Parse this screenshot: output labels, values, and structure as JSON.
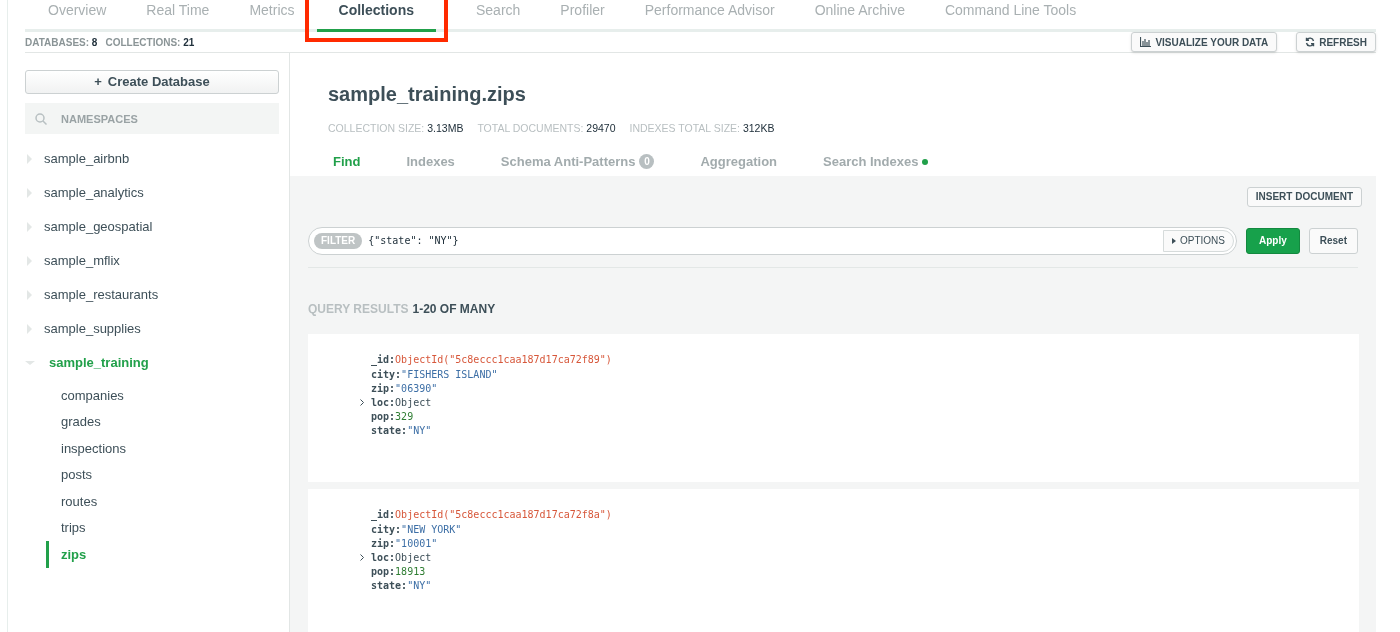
{
  "tabs": [
    {
      "label": "Overview",
      "selected": false,
      "highlighted": false
    },
    {
      "label": "Real Time",
      "selected": false,
      "highlighted": false
    },
    {
      "label": "Metrics",
      "selected": false,
      "highlighted": false
    },
    {
      "label": "Collections",
      "selected": true,
      "highlighted": true
    },
    {
      "label": "Search",
      "selected": false,
      "highlighted": false
    },
    {
      "label": "Profiler",
      "selected": false,
      "highlighted": false
    },
    {
      "label": "Performance Advisor",
      "selected": false,
      "highlighted": false
    },
    {
      "label": "Online Archive",
      "selected": false,
      "highlighted": false
    },
    {
      "label": "Command Line Tools",
      "selected": false,
      "highlighted": false
    }
  ],
  "stats": [
    {
      "label": "DATABASES:",
      "value": "8"
    },
    {
      "label": "COLLECTIONS:",
      "value": "21"
    }
  ],
  "toolbar_buttons": [
    {
      "kind": "chart",
      "label": "VISUALIZE YOUR DATA"
    },
    {
      "kind": "refresh",
      "label": "REFRESH"
    }
  ],
  "sidebar": {
    "create_button": {
      "icon": "+",
      "label": "Create Database"
    },
    "search": {
      "placeholder": "NAMESPACES"
    },
    "databases": [
      {
        "name": "sample_airbnb",
        "expanded": false
      },
      {
        "name": "sample_analytics",
        "expanded": false
      },
      {
        "name": "sample_geospatial",
        "expanded": false
      },
      {
        "name": "sample_mflix",
        "expanded": false
      },
      {
        "name": "sample_restaurants",
        "expanded": false
      },
      {
        "name": "sample_supplies",
        "expanded": false
      },
      {
        "name": "sample_training",
        "expanded": true,
        "children": [
          {
            "name": "companies",
            "selected": false
          },
          {
            "name": "grades",
            "selected": false
          },
          {
            "name": "inspections",
            "selected": false
          },
          {
            "name": "posts",
            "selected": false
          },
          {
            "name": "routes",
            "selected": false
          },
          {
            "name": "trips",
            "selected": false
          },
          {
            "name": "zips",
            "selected": true
          }
        ]
      }
    ]
  },
  "collection": {
    "title": "sample_training.zips",
    "stats": [
      {
        "label": "COLLECTION SIZE:",
        "value": "3.13MB"
      },
      {
        "label": "TOTAL DOCUMENTS:",
        "value": "29470"
      },
      {
        "label": "INDEXES TOTAL SIZE:",
        "value": "312KB"
      }
    ],
    "tabs": [
      {
        "label": "Find",
        "selected": true
      },
      {
        "label": "Indexes",
        "selected": false
      },
      {
        "label": "Schema Anti-Patterns",
        "selected": false,
        "badge": "0"
      },
      {
        "label": "Aggregation",
        "selected": false
      },
      {
        "label": "Search Indexes",
        "selected": false,
        "dot": true
      }
    ],
    "insert_button": "INSERT DOCUMENT",
    "filter": {
      "label": "FILTER",
      "value": "{\"state\": \"NY\"}",
      "options_button": "OPTIONS"
    },
    "apply_button": "Apply",
    "reset_button": "Reset",
    "results": {
      "label": "QUERY RESULTS",
      "range": "1-20 OF MANY"
    },
    "documents": [
      {
        "fields": [
          {
            "key": "_id:",
            "kind": "objectid",
            "value": "ObjectId(\"5c8eccc1caa187d17ca72f89\")"
          },
          {
            "key": "city:",
            "kind": "string",
            "value": "\"FISHERS ISLAND\""
          },
          {
            "key": "zip:",
            "kind": "string",
            "value": "\"06390\""
          },
          {
            "key": "loc:",
            "kind": "object",
            "value": "Object"
          },
          {
            "key": "pop:",
            "kind": "number",
            "value": "329"
          },
          {
            "key": "state:",
            "kind": "string",
            "value": "\"NY\""
          }
        ]
      },
      {
        "fields": [
          {
            "key": "_id:",
            "kind": "objectid",
            "value": "ObjectId(\"5c8eccc1caa187d17ca72f8a\")"
          },
          {
            "key": "city:",
            "kind": "string",
            "value": "\"NEW YORK\""
          },
          {
            "key": "zip:",
            "kind": "string",
            "value": "\"10001\""
          },
          {
            "key": "loc:",
            "kind": "object",
            "value": "Object"
          },
          {
            "key": "pop:",
            "kind": "number",
            "value": "18913"
          },
          {
            "key": "state:",
            "kind": "string",
            "value": "\"NY\""
          }
        ]
      }
    ]
  }
}
